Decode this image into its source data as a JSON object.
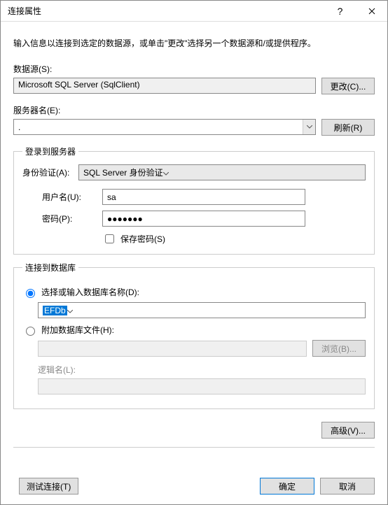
{
  "title": "连接属性",
  "intro": "输入信息以连接到选定的数据源，或单击\"更改\"选择另一个数据源和/或提供程序。",
  "datasource": {
    "label": "数据源(S):",
    "value": "Microsoft SQL Server (SqlClient)",
    "change_btn": "更改(C)..."
  },
  "server": {
    "label": "服务器名(E):",
    "value": ".",
    "refresh_btn": "刷新(R)"
  },
  "login_group": {
    "legend": "登录到服务器",
    "auth_label": "身份验证(A):",
    "auth_value": "SQL Server 身份验证",
    "user_label": "用户名(U):",
    "user_value": "sa",
    "pwd_label": "密码(P):",
    "pwd_value": "●●●●●●●",
    "save_pwd_label": "保存密码(S)"
  },
  "db_group": {
    "legend": "连接到数据库",
    "select_radio_label": "选择或输入数据库名称(D):",
    "db_value": "EFDb",
    "attach_radio_label": "附加数据库文件(H):",
    "browse_btn": "浏览(B)...",
    "logical_label": "逻辑名(L):"
  },
  "advanced_btn": "高级(V)...",
  "footer": {
    "test_btn": "测试连接(T)",
    "ok_btn": "确定",
    "cancel_btn": "取消"
  }
}
